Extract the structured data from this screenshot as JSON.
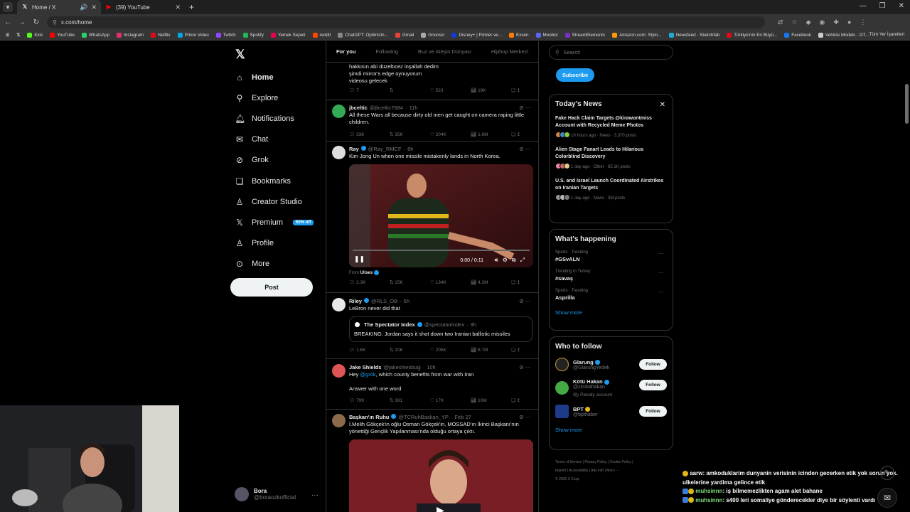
{
  "browser": {
    "tabs": [
      {
        "label": "Home / X",
        "icon": "x-logo-icon",
        "active": true
      },
      {
        "label": "(39) YouTube",
        "icon": "youtube-icon",
        "active": false
      }
    ],
    "url": "x.com/home",
    "bookmarks": [
      "Kick",
      "YouTube",
      "WhatsApp",
      "Instagram",
      "Netflix",
      "Prime Video",
      "Twitch",
      "Spotify",
      "Yemek Sepeti",
      "reddit",
      "ChatGPT: Optimizin...",
      "Gmail",
      "Gnoosic",
      "Disney+ | Filmler ve...",
      "Exxen",
      "Moobot",
      "StreamElements",
      "Amazon.com: Stylo...",
      "Newsfeed - Sketchfab",
      "Türkiye'nin En Büyü...",
      "Facebook",
      "Vehicle Models - GT..."
    ],
    "bookmarks_right": "Tüm Yer İşaretleri"
  },
  "nav": {
    "items": [
      {
        "label": "Home",
        "icon": "home-icon"
      },
      {
        "label": "Explore",
        "icon": "search-icon"
      },
      {
        "label": "Notifications",
        "icon": "bell-icon"
      },
      {
        "label": "Chat",
        "icon": "mail-icon"
      },
      {
        "label": "Grok",
        "icon": "grok-icon"
      },
      {
        "label": "Bookmarks",
        "icon": "bookmark-icon"
      },
      {
        "label": "Creator Studio",
        "icon": "creator-studio-icon"
      },
      {
        "label": "Premium",
        "icon": "x-premium-icon"
      },
      {
        "label": "Profile",
        "icon": "profile-icon"
      },
      {
        "label": "More",
        "icon": "more-icon"
      }
    ],
    "premium_badge": "50% off",
    "post_button": "Post",
    "account": {
      "name": "Bora",
      "handle": "@boraozkofficial"
    }
  },
  "feed": {
    "tabs": [
      "For you",
      "Following",
      "Buz ve Ateşin Dünyası",
      "Hiphop Merkezi"
    ],
    "tweets": [
      {
        "text": "hakkısın abi düzeltıcez inşallah dedim\nşimdi mirror's edge oynuyorum\nvideosu gelecek",
        "replies": "7",
        "reposts": "",
        "likes": "523",
        "views": "19K"
      },
      {
        "name": "jbceltic",
        "handle": "@jbceltic7684",
        "time": "11h",
        "text": "All these Wars all because dirty old men get caught on camera raping little children.",
        "replies": "338",
        "reposts": "35K",
        "likes": "204K",
        "views": "1.6M"
      },
      {
        "name": "Ray",
        "handle": "@Ray_RMCF",
        "time": "8h",
        "text": "Kim Jong Un when one missile mistakenly lands in North Korea.",
        "video_time": "0:00 / 0:11",
        "from_label": "From",
        "from_name": "Ulises",
        "replies": "2.3K",
        "reposts": "15K",
        "likes": "134K",
        "views": "4.2M"
      },
      {
        "name": "Riley",
        "handle": "@RLS_OB",
        "time": "5h",
        "text": "LeBron never did that",
        "quote": {
          "name": "The Spectator Index",
          "handle": "@spectatorindex",
          "time": "9h",
          "text": "BREAKING: Jordan says it shot down two Iranian ballistic missiles"
        },
        "replies": "1.6K",
        "reposts": "20K",
        "likes": "205K",
        "views": "6.7M"
      },
      {
        "name": "Jake Shields",
        "handle": "@jakeshieldsajj",
        "time": "10h",
        "text_pre": "Hey ",
        "mention": "@grok",
        "text_post": ", which county benefits from war with Iran",
        "text2": "Answer with one word",
        "replies": "799",
        "reposts": "381",
        "likes": "17K",
        "views": "10M"
      },
      {
        "name": "Başkan'ın Ruhu",
        "handle": "@TCRuhBaskan_YP",
        "time": "Feb 27",
        "text": "İ.Melih Gökçek'in oğlu Osman Gökçek'in, MOSSAD'ın İkinci Başkanı'nın yönettiği Gençlik Yapılanması'nda olduğu ortaya çıktı."
      }
    ]
  },
  "right": {
    "search_placeholder": "Search",
    "subscribe": "Subscribe",
    "news": {
      "title": "Today's News",
      "items": [
        {
          "title": "Fake Hack Claim Targets @kirawontmiss Account with Recycled Meme Photos",
          "meta": "10 hours ago · News · 3,370 posts"
        },
        {
          "title": "Alien Stage Fanart Leads to Hilarious Colorblind Discovery",
          "meta": "1 day ago · Other · 65.1K posts"
        },
        {
          "title": "U.S. and Israel Launch Coordinated Airstrikes on Iranian Targets",
          "meta": "1 day ago · News · 3M posts"
        }
      ]
    },
    "happening": {
      "title": "What's happening",
      "trends": [
        {
          "meta": "Sports · Trending",
          "name": "#GSvALN"
        },
        {
          "meta": "Trending in Turkey",
          "name": "#savaş"
        },
        {
          "meta": "Sports · Trending",
          "name": "Asprilla"
        }
      ],
      "show_more": "Show more"
    },
    "follow": {
      "title": "Who to follow",
      "users": [
        {
          "name": "Glarung",
          "handle": "@GlarungYedek",
          "extra": "",
          "button": "Follow"
        },
        {
          "name": "Kötü Hakan",
          "handle": "@zimbahakan",
          "extra": "Parody account",
          "button": "Follow"
        },
        {
          "name": "BPT",
          "handle": "@bpthaber",
          "extra": "",
          "button": "Follow"
        }
      ],
      "show_more": "Show more"
    },
    "footer": [
      "Terms of Service",
      "Privacy Policy",
      "Cookie Policy",
      "Imprint",
      "Accessibility",
      "Ads info",
      "More ···",
      "© 2026 X Corp."
    ]
  },
  "chat": {
    "messages": [
      {
        "user": "aarw",
        "text": ": amkoduklarim dunyanin verisinin icinden gecerken etik yok sorun yok. ulkelerine yardima gelince etik"
      },
      {
        "user": "muhsinnn",
        "text": ": iş bilmemezlikten agam alet bahane"
      },
      {
        "user": "muhsinnn",
        "text": ": s400 leri somaliye gönderecekler diye bir söylenti vardı"
      }
    ]
  }
}
